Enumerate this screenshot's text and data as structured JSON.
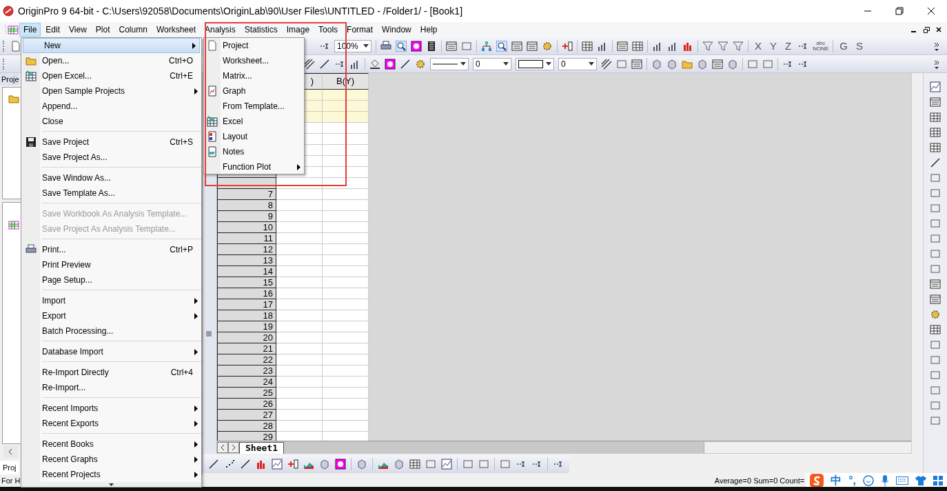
{
  "window": {
    "title": "OriginPro 9 64-bit - C:\\Users\\92058\\Documents\\OriginLab\\90\\User Files\\UNTITLED - /Folder1/ - [Book1]"
  },
  "menu_bar": [
    {
      "label": "File",
      "selected": true
    },
    {
      "label": "Edit",
      "selected": false
    },
    {
      "label": "View",
      "selected": false
    },
    {
      "label": "Plot",
      "selected": false
    },
    {
      "label": "Column",
      "selected": false
    },
    {
      "label": "Worksheet",
      "selected": false
    },
    {
      "label": "Analysis",
      "selected": false
    },
    {
      "label": "Statistics",
      "selected": false
    },
    {
      "label": "Image",
      "selected": false
    },
    {
      "label": "Tools",
      "selected": false
    },
    {
      "label": "Format",
      "selected": false
    },
    {
      "label": "Window",
      "selected": false
    },
    {
      "label": "Help",
      "selected": false
    }
  ],
  "toolbar": {
    "zoom_combo": "100%",
    "number_combos": [
      "0",
      "0"
    ],
    "axis_buttons": [
      "X",
      "Y",
      "Z"
    ],
    "label_button_top": "abc",
    "label_button_bottom": "NONE",
    "group_buttons": [
      "G",
      "S"
    ]
  },
  "project_explorer": {
    "tab": "Proje",
    "bottom_tab": "Proj"
  },
  "file_menu": [
    {
      "kind": "item",
      "label": "New",
      "submenu": true,
      "selected": true,
      "disabled": false
    },
    {
      "kind": "item",
      "label": "Open...",
      "shortcut": "Ctrl+O",
      "submenu": false,
      "selected": false,
      "disabled": false
    },
    {
      "kind": "item",
      "label": "Open Excel...",
      "shortcut": "Ctrl+E",
      "submenu": false,
      "selected": false,
      "disabled": false
    },
    {
      "kind": "item",
      "label": "Open Sample Projects",
      "submenu": true,
      "selected": false,
      "disabled": false
    },
    {
      "kind": "item",
      "label": "Append...",
      "submenu": false,
      "selected": false,
      "disabled": false
    },
    {
      "kind": "item",
      "label": "Close",
      "submenu": false,
      "selected": false,
      "disabled": false
    },
    {
      "kind": "separator"
    },
    {
      "kind": "item",
      "label": "Save Project",
      "shortcut": "Ctrl+S",
      "submenu": false,
      "selected": false,
      "disabled": false
    },
    {
      "kind": "item",
      "label": "Save Project As...",
      "submenu": false,
      "selected": false,
      "disabled": false
    },
    {
      "kind": "separator"
    },
    {
      "kind": "item",
      "label": "Save Window As...",
      "submenu": false,
      "selected": false,
      "disabled": false
    },
    {
      "kind": "item",
      "label": "Save Template As...",
      "submenu": false,
      "selected": false,
      "disabled": false
    },
    {
      "kind": "separator"
    },
    {
      "kind": "item",
      "label": "Save Workbook As Analysis Template...",
      "submenu": false,
      "selected": false,
      "disabled": true
    },
    {
      "kind": "item",
      "label": "Save Project As Analysis Template...",
      "submenu": false,
      "selected": false,
      "disabled": true
    },
    {
      "kind": "separator"
    },
    {
      "kind": "item",
      "label": "Print...",
      "shortcut": "Ctrl+P",
      "submenu": false,
      "selected": false,
      "disabled": false
    },
    {
      "kind": "item",
      "label": "Print Preview",
      "submenu": false,
      "selected": false,
      "disabled": false
    },
    {
      "kind": "item",
      "label": "Page Setup...",
      "submenu": false,
      "selected": false,
      "disabled": false
    },
    {
      "kind": "separator"
    },
    {
      "kind": "item",
      "label": "Import",
      "submenu": true,
      "selected": false,
      "disabled": false
    },
    {
      "kind": "item",
      "label": "Export",
      "submenu": true,
      "selected": false,
      "disabled": false
    },
    {
      "kind": "item",
      "label": "Batch Processing...",
      "submenu": false,
      "selected": false,
      "disabled": false
    },
    {
      "kind": "separator"
    },
    {
      "kind": "item",
      "label": "Database Import",
      "submenu": true,
      "selected": false,
      "disabled": false
    },
    {
      "kind": "separator"
    },
    {
      "kind": "item",
      "label": "Re-Import Directly",
      "shortcut": "Ctrl+4",
      "submenu": false,
      "selected": false,
      "disabled": false
    },
    {
      "kind": "item",
      "label": "Re-Import...",
      "submenu": false,
      "selected": false,
      "disabled": false
    },
    {
      "kind": "separator"
    },
    {
      "kind": "item",
      "label": "Recent Imports",
      "submenu": true,
      "selected": false,
      "disabled": false
    },
    {
      "kind": "item",
      "label": "Recent Exports",
      "submenu": true,
      "selected": false,
      "disabled": false
    },
    {
      "kind": "separator"
    },
    {
      "kind": "item",
      "label": "Recent Books",
      "submenu": true,
      "selected": false,
      "disabled": false
    },
    {
      "kind": "item",
      "label": "Recent Graphs",
      "submenu": true,
      "selected": false,
      "disabled": false
    },
    {
      "kind": "item",
      "label": "Recent Projects",
      "submenu": true,
      "selected": false,
      "disabled": false
    }
  ],
  "new_submenu": [
    {
      "label": "Project",
      "submenu": false
    },
    {
      "label": "Worksheet...",
      "submenu": false
    },
    {
      "label": "Matrix...",
      "submenu": false
    },
    {
      "label": "Graph",
      "submenu": false
    },
    {
      "label": "From Template...",
      "submenu": false
    },
    {
      "label": "Excel",
      "submenu": false
    },
    {
      "label": "Layout",
      "submenu": false
    },
    {
      "label": "Notes",
      "submenu": false
    },
    {
      "label": "Function Plot",
      "submenu": true
    }
  ],
  "worksheet": {
    "columns": [
      ")",
      "B(Y)"
    ],
    "row_numbers": [
      "7",
      "8",
      "9",
      "10",
      "11",
      "12",
      "13",
      "14",
      "15",
      "16",
      "17",
      "18",
      "19",
      "20",
      "21",
      "22",
      "23",
      "24",
      "25",
      "26",
      "27",
      "28",
      "29"
    ],
    "sheet_tab": "Sheet1"
  },
  "status_bar": {
    "left": "For H",
    "right": "Average=0 Sum=0 Count="
  },
  "ime_bar": {
    "mode": "中",
    "punctuation": "°,"
  }
}
